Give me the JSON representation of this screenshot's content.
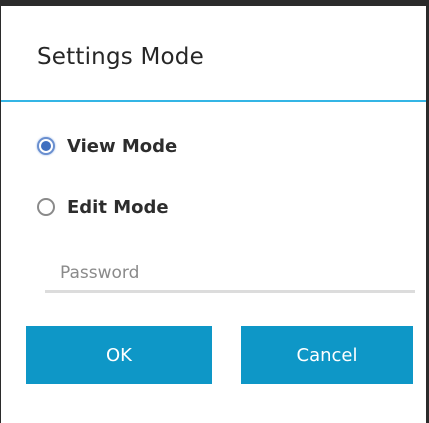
{
  "dialog": {
    "title": "Settings Mode",
    "accent_color": "#34b5e5",
    "options": [
      {
        "label": "View Mode",
        "checked": true
      },
      {
        "label": "Edit Mode",
        "checked": false
      }
    ],
    "password": {
      "placeholder": "Password",
      "value": ""
    },
    "buttons": {
      "ok_label": "OK",
      "cancel_label": "Cancel",
      "color": "#0e97c7"
    }
  }
}
